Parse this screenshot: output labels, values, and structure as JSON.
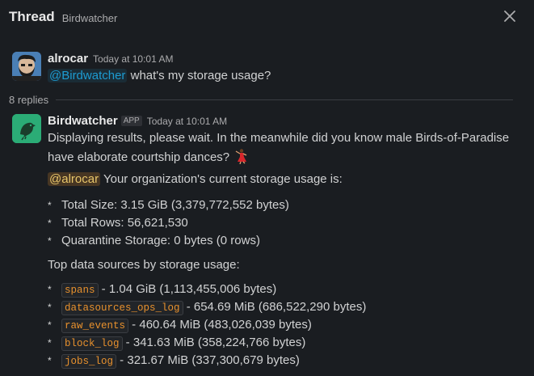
{
  "header": {
    "title": "Thread",
    "subtitle": "Birdwatcher"
  },
  "original_message": {
    "author": "alrocar",
    "time": "Today at 10:01 AM",
    "mention": "@Birdwatcher",
    "text": " what's my storage usage?"
  },
  "replies": {
    "label": "8 replies"
  },
  "reply": {
    "author": "Birdwatcher",
    "badge": "APP",
    "time": "Today at 10:01 AM",
    "line1": "Displaying results, please wait. In the meanwhile did you know male Birds-of-Paradise",
    "line2": "have elaborate courtship dances?",
    "mention": "@alrocar",
    "intro": " Your organization's current storage usage is:",
    "stats": [
      "Total Size: 3.15 GiB (3,379,772,552 bytes)",
      "Total Rows: 56,621,530",
      "Quarantine Storage: 0 bytes (0 rows)"
    ],
    "top_heading": "Top data sources by storage usage:",
    "sources": [
      {
        "name": "spans",
        "size": " - 1.04 GiB (1,113,455,006 bytes)"
      },
      {
        "name": "datasources_ops_log",
        "size": " - 654.69 MiB (686,522,290 bytes)"
      },
      {
        "name": "raw_events",
        "size": " - 460.64 MiB (483,026,039 bytes)"
      },
      {
        "name": "block_log",
        "size": " - 341.63 MiB (358,224,766 bytes)"
      },
      {
        "name": "jobs_log",
        "size": " - 321.67 MiB (337,300,679 bytes)"
      }
    ],
    "bullet": "*"
  },
  "icons": {
    "close": "close-icon",
    "dancer": "dancer-emoji",
    "bird": "bird-logo"
  },
  "colors": {
    "background": "#1a1d21",
    "mention": "#1d9bd1",
    "code": "#e8912d",
    "app_avatar": "#2bac76"
  }
}
